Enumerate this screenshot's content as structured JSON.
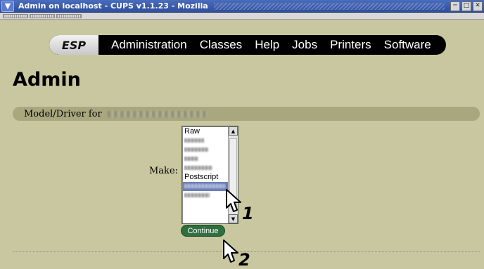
{
  "window": {
    "title": "Admin on localhost - CUPS v1.1.23 - Mozilla",
    "buttons": [
      "minimize-icon",
      "maximize-icon",
      "close-icon"
    ]
  },
  "nav": {
    "logo": "ESP",
    "items": [
      "Administration",
      "Classes",
      "Help",
      "Jobs",
      "Printers",
      "Software"
    ]
  },
  "page": {
    "heading": "Admin",
    "section_label": "Model/Driver for"
  },
  "form": {
    "make_label": "Make:",
    "options": [
      "Raw",
      "",
      "",
      "",
      "",
      "Postscript",
      "",
      ""
    ],
    "selected_index": 6,
    "continue_label": "Continue"
  },
  "callouts": {
    "one": "1",
    "two": "2"
  },
  "colors": {
    "page_bg": "#c8c7a0",
    "section_bar": "#a8a77e",
    "nav_bg": "#000000",
    "continue_bg": "#2f6e3f",
    "selection": "#6b7fb7"
  }
}
